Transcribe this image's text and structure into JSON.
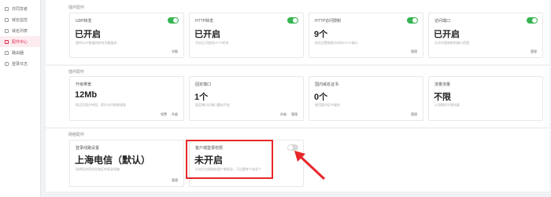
{
  "sidebar": {
    "items": [
      {
        "label": "共同享者"
      },
      {
        "label": "域名监控"
      },
      {
        "label": "域名列表"
      },
      {
        "label": "配件中心"
      },
      {
        "label": "路由器"
      },
      {
        "label": "登录日志"
      }
    ]
  },
  "sections": {
    "s1_title": "插件配件",
    "s2_title": "插件配件",
    "s3_title": "网络配件"
  },
  "row1": [
    {
      "label": "UDP转发",
      "value": "已开启",
      "desc": "提供UDP数据的转发功能服务",
      "links": [
        "详细"
      ]
    },
    {
      "label": "HTTP转发",
      "value": "已开启",
      "desc": "开启后可使用HTTP转发",
      "links": []
    },
    {
      "label": "HTTP访问限制",
      "value": "9个",
      "desc": "前往设置限制访问的HTTP端口",
      "links": [
        "管理"
      ]
    },
    {
      "label": "访问端口",
      "value": "已开启",
      "desc": "允许托管映射的端口范围",
      "links": [
        "管理"
      ]
    }
  ],
  "row2": [
    {
      "label": "升级带宽",
      "value": "12Mb",
      "desc": "购买后提升带宽，提升访问效果速度",
      "links": [
        "续费",
        "升级"
      ]
    },
    {
      "label": "固定端口",
      "value": "1个",
      "desc": "固定端口后端口重启不变",
      "links": [
        "升级",
        "管理"
      ]
    },
    {
      "label": "国内域名证书",
      "value": "0个",
      "desc": "使用国内证书服务",
      "links": [
        "管理"
      ]
    },
    {
      "label": "流量流量",
      "value": "不限",
      "desc": "公测期间不限流量",
      "links": []
    }
  ],
  "row3": [
    {
      "label": "登录线路设置",
      "value": "上海电信（默认）",
      "desc": "选择适合您所在地区的登录线路",
      "links": [
        "管理"
      ]
    },
    {
      "label": "客户端登录权限",
      "value": "未开启",
      "desc": "开启后仅限指定客户端登录，可设置单个或多个",
      "links": []
    }
  ],
  "colors": {
    "accent": "#e0264f",
    "toggle_on": "#35b453",
    "highlight": "#e8262a"
  }
}
